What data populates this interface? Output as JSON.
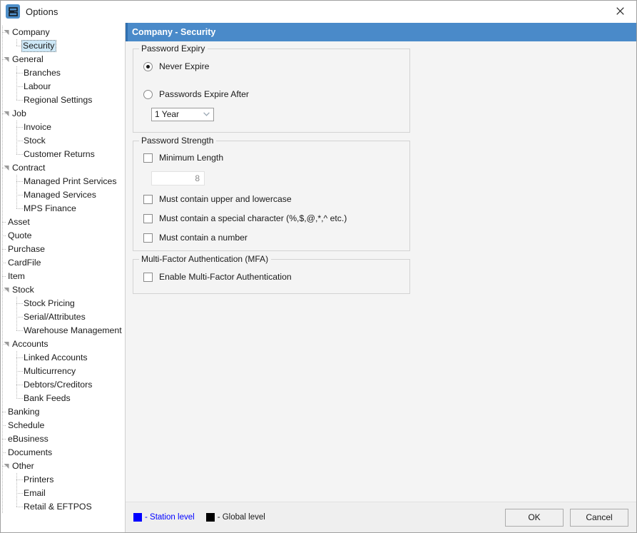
{
  "window": {
    "title": "Options",
    "icon": "database-icon",
    "close_label": "✕"
  },
  "sidebar": {
    "nodes": [
      {
        "label": "Company",
        "level": 0,
        "expander": true,
        "selected": false
      },
      {
        "label": "Security",
        "level": 1,
        "expander": false,
        "selected": true
      },
      {
        "label": "General",
        "level": 0,
        "expander": true,
        "selected": false
      },
      {
        "label": "Branches",
        "level": 1,
        "expander": false,
        "selected": false
      },
      {
        "label": "Labour",
        "level": 1,
        "expander": false,
        "selected": false
      },
      {
        "label": "Regional Settings",
        "level": 1,
        "expander": false,
        "selected": false
      },
      {
        "label": "Job",
        "level": 0,
        "expander": true,
        "selected": false
      },
      {
        "label": "Invoice",
        "level": 1,
        "expander": false,
        "selected": false
      },
      {
        "label": "Stock",
        "level": 1,
        "expander": false,
        "selected": false
      },
      {
        "label": "Customer Returns",
        "level": 1,
        "expander": false,
        "selected": false
      },
      {
        "label": "Contract",
        "level": 0,
        "expander": true,
        "selected": false
      },
      {
        "label": "Managed Print Services",
        "level": 1,
        "expander": false,
        "selected": false
      },
      {
        "label": "Managed Services",
        "level": 1,
        "expander": false,
        "selected": false
      },
      {
        "label": "MPS Finance",
        "level": 1,
        "expander": false,
        "selected": false
      },
      {
        "label": "Asset",
        "level": 0,
        "expander": false,
        "selected": false
      },
      {
        "label": "Quote",
        "level": 0,
        "expander": false,
        "selected": false
      },
      {
        "label": "Purchase",
        "level": 0,
        "expander": false,
        "selected": false
      },
      {
        "label": "CardFile",
        "level": 0,
        "expander": false,
        "selected": false
      },
      {
        "label": "Item",
        "level": 0,
        "expander": false,
        "selected": false
      },
      {
        "label": "Stock",
        "level": 0,
        "expander": true,
        "selected": false
      },
      {
        "label": "Stock Pricing",
        "level": 1,
        "expander": false,
        "selected": false
      },
      {
        "label": "Serial/Attributes",
        "level": 1,
        "expander": false,
        "selected": false
      },
      {
        "label": "Warehouse Management",
        "level": 1,
        "expander": false,
        "selected": false
      },
      {
        "label": "Accounts",
        "level": 0,
        "expander": true,
        "selected": false
      },
      {
        "label": "Linked Accounts",
        "level": 1,
        "expander": false,
        "selected": false
      },
      {
        "label": "Multicurrency",
        "level": 1,
        "expander": false,
        "selected": false
      },
      {
        "label": "Debtors/Creditors",
        "level": 1,
        "expander": false,
        "selected": false
      },
      {
        "label": "Bank Feeds",
        "level": 1,
        "expander": false,
        "selected": false
      },
      {
        "label": "Banking",
        "level": 0,
        "expander": false,
        "selected": false
      },
      {
        "label": "Schedule",
        "level": 0,
        "expander": false,
        "selected": false
      },
      {
        "label": "eBusiness",
        "level": 0,
        "expander": false,
        "selected": false
      },
      {
        "label": "Documents",
        "level": 0,
        "expander": false,
        "selected": false
      },
      {
        "label": "Other",
        "level": 0,
        "expander": true,
        "selected": false
      },
      {
        "label": "Printers",
        "level": 1,
        "expander": false,
        "selected": false
      },
      {
        "label": "Email",
        "level": 1,
        "expander": false,
        "selected": false
      },
      {
        "label": "Retail & EFTPOS",
        "level": 1,
        "expander": false,
        "selected": false
      }
    ]
  },
  "content": {
    "header_title": "Company - Security",
    "password_expiry": {
      "title": "Password Expiry",
      "never_expire_label": "Never Expire",
      "never_expire_checked": true,
      "expire_after_label": "Passwords Expire After",
      "expire_after_checked": false,
      "period_value": "1 Year",
      "period_options": [
        "1 Year"
      ]
    },
    "password_strength": {
      "title": "Password Strength",
      "minimum_length_label": "Minimum Length",
      "minimum_length_checked": false,
      "minimum_length_value": "8",
      "upper_lower_label": "Must contain upper and lowercase",
      "upper_lower_checked": false,
      "special_char_label": "Must contain a special character (%,$,@,*,^ etc.)",
      "special_char_checked": false,
      "number_label": "Must contain a number",
      "number_checked": false
    },
    "mfa": {
      "title": "Multi-Factor Authentication (MFA)",
      "enable_label": "Enable Multi-Factor Authentication",
      "enable_checked": false
    }
  },
  "footer": {
    "legend": [
      {
        "color": "#0000ff",
        "text": "- Station level"
      },
      {
        "color": "#000000",
        "text": "- Global level"
      }
    ],
    "ok_label": "OK",
    "cancel_label": "Cancel"
  },
  "colors": {
    "header_blue": "#4a8ac9",
    "selection_blue": "#cde8f7",
    "station_level": "#0000ff",
    "global_level": "#000000"
  }
}
